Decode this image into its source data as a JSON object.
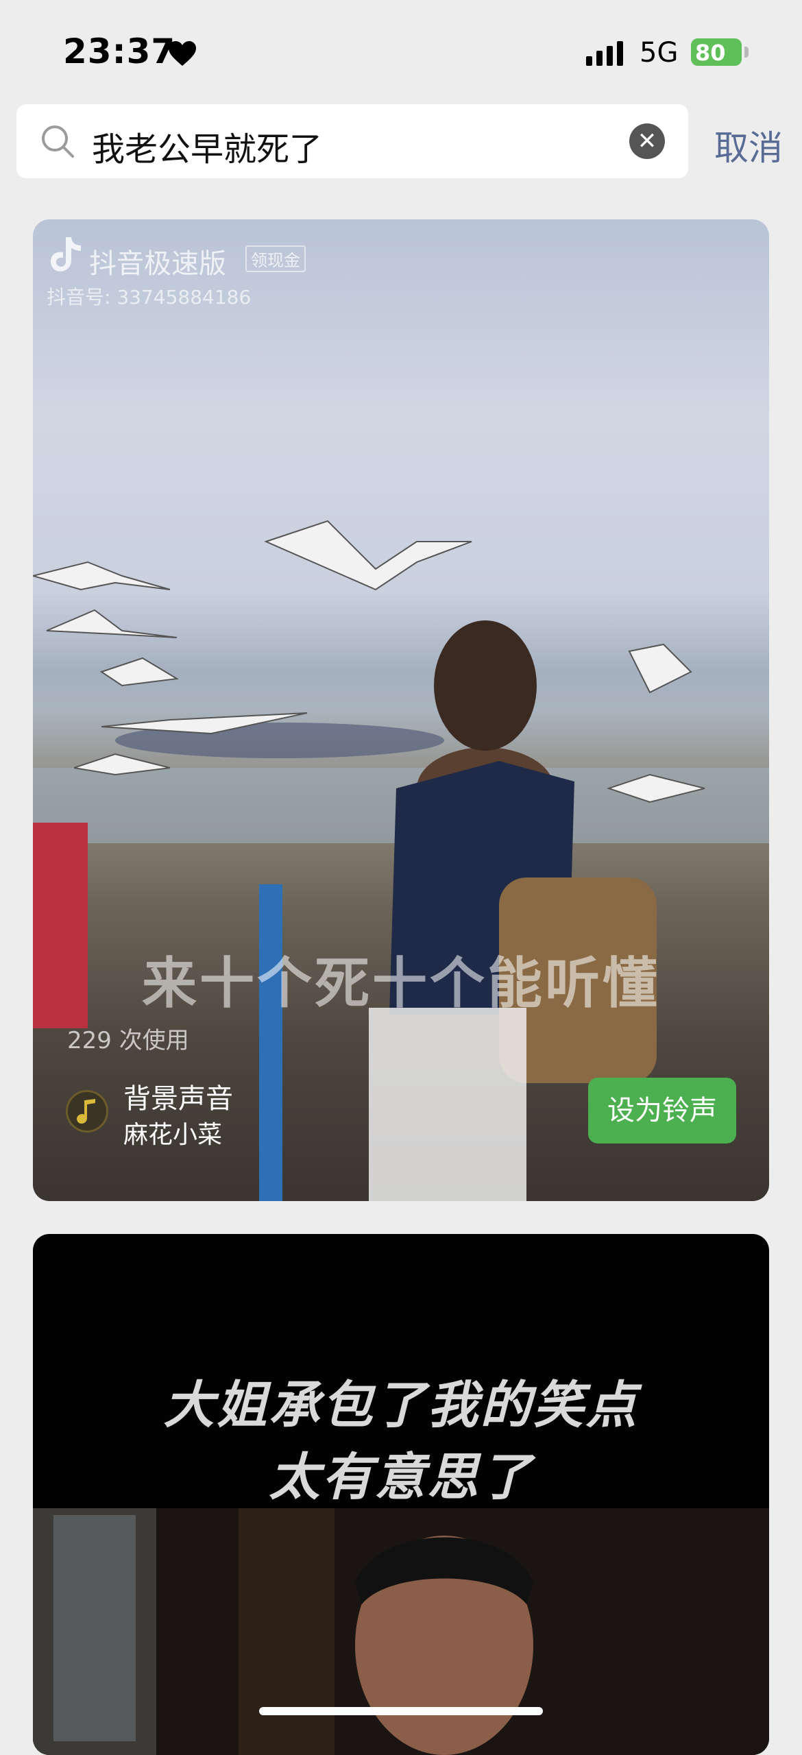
{
  "status_bar": {
    "time": "23:37",
    "network": "5G",
    "battery": "80"
  },
  "search": {
    "query": "我老公早就死了",
    "cancel_label": "取消"
  },
  "results": [
    {
      "watermark_app": "抖音极速版",
      "watermark_badge": "领现金",
      "watermark_id": "抖音号: 33745884186",
      "lyric": "来十个死十个能听懂",
      "usage": "229 次使用",
      "sound_title": "背景声音",
      "sound_author": "麻花小菜",
      "ringtone_label": "设为铃声"
    },
    {
      "caption_line1": "大姐承包了我的笑点",
      "caption_line2": "太有意思了"
    }
  ],
  "colors": {
    "accent_green": "#4caf50",
    "link_blue": "#576b95",
    "battery_green": "#5fc05a"
  }
}
